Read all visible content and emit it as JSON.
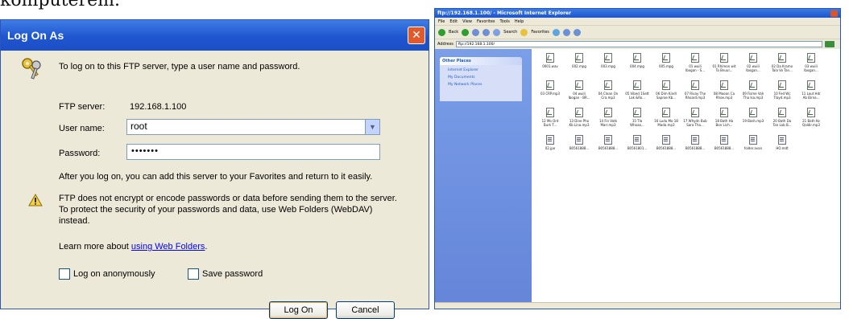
{
  "caption": "komputerem.",
  "dialog": {
    "title": "Log On As",
    "intro": "To log on to this FTP server, type a user name and password.",
    "server_label": "FTP server:",
    "server_value": "192.168.1.100",
    "username_label": "User name:",
    "username_value": "root",
    "password_label": "Password:",
    "password_value": "•••••••",
    "after_text": "After you log on, you can add this server to your Favorites and return to it easily.",
    "warning_text": "FTP does not encrypt or encode passwords or data before sending them to the server.  To protect the security of your passwords and data, use Web Folders (WebDAV) instead.",
    "learn_prefix": "Learn more about ",
    "learn_link": "using Web Folders",
    "learn_suffix": ".",
    "anon_label": "Log on anonymously",
    "save_label": "Save password",
    "logon_button": "Log On",
    "cancel_button": "Cancel"
  },
  "explorer": {
    "title": "ftp://192.168.1.100/ - Microsoft Internet Explorer",
    "menu": [
      "File",
      "Edit",
      "View",
      "Favorites",
      "Tools",
      "Help"
    ],
    "toolbar": [
      "Back",
      "Search",
      "Favorites"
    ],
    "address_label": "Address",
    "address_value": "ftp://192.168.1.100/",
    "sidebar_header": "Other Places",
    "sidebar_items": [
      "Internet Explorer",
      "My Documents",
      "My Network Places"
    ],
    "files": [
      "0001.wav",
      "002.mpg",
      "003.mpg",
      "004.mpg",
      "005.mpg",
      "01 wuili Ibogan - S...",
      "01 Rhimon wit Ta Bnuul...",
      "02 wuili Ibogan...",
      "02 Da Kramo Tala Vo Tan...",
      "03 wuili Ibogan...",
      "03 CRP.mp3",
      "04 wuili Ibogan - BR...",
      "04 Clean On Cra.mp3",
      "05 Vibed 1Sett Lak &Ro...",
      "06 Dim Kindl Saproe Kb...",
      "07 Rivay The Rhoard.mp3",
      "08 Mooon Ca Rhoe.mp3",
      "09 Fisme Vah Tha Isa.mp3",
      "10 Fed Wc Tlayd.mp3",
      "11 Lout Hdr Ab Birna...",
      "12 Mo Ord Burk T...",
      "13 Dine Pho Kb Lina.mp3",
      "14 Fin Vatk Marr.mp3",
      "15 Tla Whoaa...",
      "16 Ludu Mo 18 Mada.mp3",
      "17 Whydn Bub Sara Tha...",
      "18 Bath Ha Bon Lich...",
      "19 Bash.mp3",
      "20 Bath Da Tan Lob B...",
      "21 Bath Ke Qaldir.mp3",
      "02.jpe",
      "B0561888...",
      "B0561888...",
      "B0561801...",
      "B0561888...",
      "B0561888...",
      "B0561888...",
      "folder.avan",
      "HO.mdt"
    ],
    "file_kinds": [
      "audio",
      "audio",
      "audio",
      "audio",
      "audio",
      "audio",
      "audio",
      "audio",
      "audio",
      "audio",
      "audio",
      "audio",
      "audio",
      "audio",
      "audio",
      "audio",
      "audio",
      "audio",
      "audio",
      "audio",
      "audio",
      "audio",
      "audio",
      "audio",
      "audio",
      "audio",
      "audio",
      "audio",
      "audio",
      "audio",
      "doc",
      "doc",
      "doc",
      "doc",
      "doc",
      "doc",
      "doc",
      "doc",
      "doc"
    ]
  },
  "colors": {
    "xp_title": "#1f55d0",
    "dialog_bg": "#ece9d8",
    "link": "#0000ff",
    "close_button": "#e05a2d"
  }
}
